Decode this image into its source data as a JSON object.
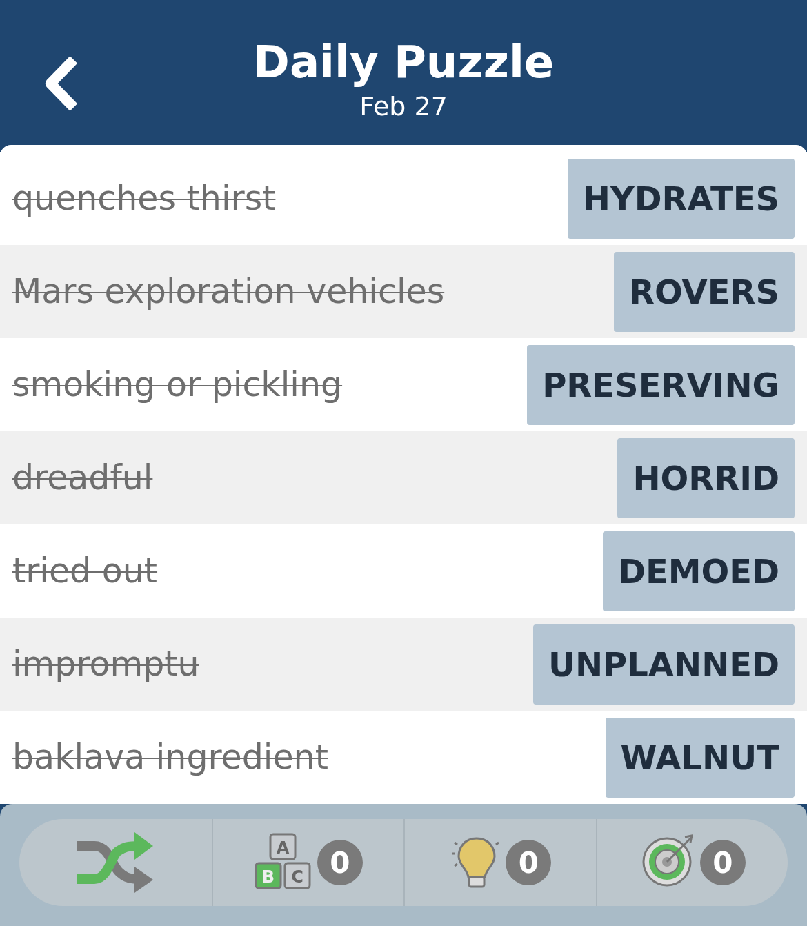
{
  "header": {
    "title": "Daily Puzzle",
    "subtitle": "Feb 27"
  },
  "clues": [
    {
      "clue": "quenches thirst",
      "answer": "HYDRATES",
      "solved": true
    },
    {
      "clue": "Mars exploration vehicles",
      "answer": "ROVERS",
      "solved": true
    },
    {
      "clue": "smoking or pickling",
      "answer": "PRESERVING",
      "solved": true
    },
    {
      "clue": "dreadful",
      "answer": "HORRID",
      "solved": true
    },
    {
      "clue": "tried out",
      "answer": "DEMOED",
      "solved": true
    },
    {
      "clue": "impromptu",
      "answer": "UNPLANNED",
      "solved": true
    },
    {
      "clue": "baklava ingredient",
      "answer": "WALNUT",
      "solved": true
    }
  ],
  "toolbar": [
    {
      "kind": "shuffle"
    },
    {
      "kind": "letters",
      "letters": [
        "A",
        "B",
        "C"
      ],
      "count": "0"
    },
    {
      "kind": "hint",
      "count": "0"
    },
    {
      "kind": "target",
      "count": "0"
    }
  ]
}
